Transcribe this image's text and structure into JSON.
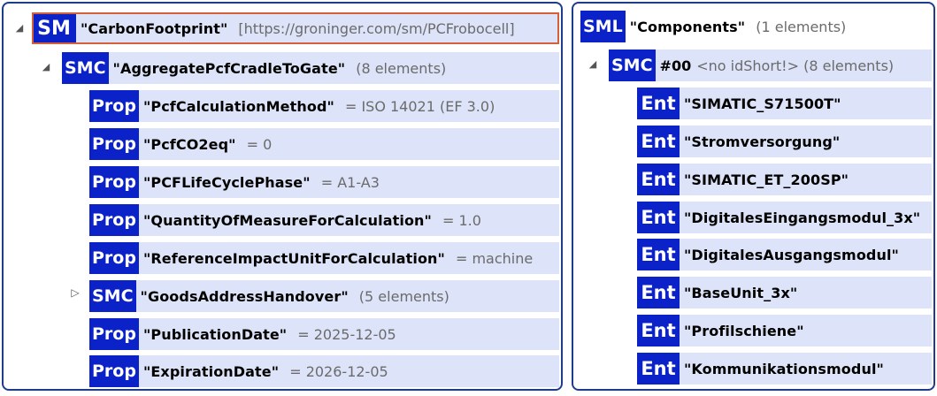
{
  "left": {
    "root": {
      "badge": "SM",
      "name": "\"CarbonFootprint\"",
      "info": "[https://groninger.com/sm/PCFrobocell]"
    },
    "collection": {
      "badge": "SMC",
      "name": "\"AggregatePcfCradleToGate\"",
      "info": "(8 elements)"
    },
    "items": [
      {
        "badge": "Prop",
        "name": "\"PcfCalculationMethod\"",
        "info": "= ISO 14021 (EF 3.0)"
      },
      {
        "badge": "Prop",
        "name": "\"PcfCO2eq\"",
        "info": "= 0"
      },
      {
        "badge": "Prop",
        "name": "\"PCFLifeCyclePhase\"",
        "info": "= A1-A3"
      },
      {
        "badge": "Prop",
        "name": "\"QuantityOfMeasureForCalculation\"",
        "info": "= 1.0"
      },
      {
        "badge": "Prop",
        "name": "\"ReferenceImpactUnitForCalculation\"",
        "info": "= machine"
      },
      {
        "badge": "SMC",
        "name": "\"GoodsAddressHandover\"",
        "info": "(5 elements)"
      },
      {
        "badge": "Prop",
        "name": "\"PublicationDate\"",
        "info": "= 2025-12-05"
      },
      {
        "badge": "Prop",
        "name": "\"ExpirationDate\"",
        "info": "= 2026-12-05"
      }
    ]
  },
  "right": {
    "root": {
      "badge": "SML",
      "name": "\"Components\"",
      "info": "(1 elements)"
    },
    "collection": {
      "badge": "SMC",
      "hash": "#00",
      "info": "<no idShort!> (8 elements)"
    },
    "entities": [
      {
        "badge": "Ent",
        "name": "\"SIMATIC_S71500T\""
      },
      {
        "badge": "Ent",
        "name": "\"Stromversorgung\""
      },
      {
        "badge": "Ent",
        "name": "\"SIMATIC_ET_200SP\""
      },
      {
        "badge": "Ent",
        "name": "\"DigitalesEingangsmodul_3x\""
      },
      {
        "badge": "Ent",
        "name": "\"DigitalesAusgangsmodul\""
      },
      {
        "badge": "Ent",
        "name": "\"BaseUnit_3x\""
      },
      {
        "badge": "Ent",
        "name": "\"Profilschiene\""
      },
      {
        "badge": "Ent",
        "name": "\"Kommunikationsmodul\""
      }
    ]
  },
  "colors": {
    "badge_bg": "#0b22c8",
    "row_bg": "#dde3f8",
    "selection": "#d4603a",
    "panel_border": "#1e3c8c"
  }
}
